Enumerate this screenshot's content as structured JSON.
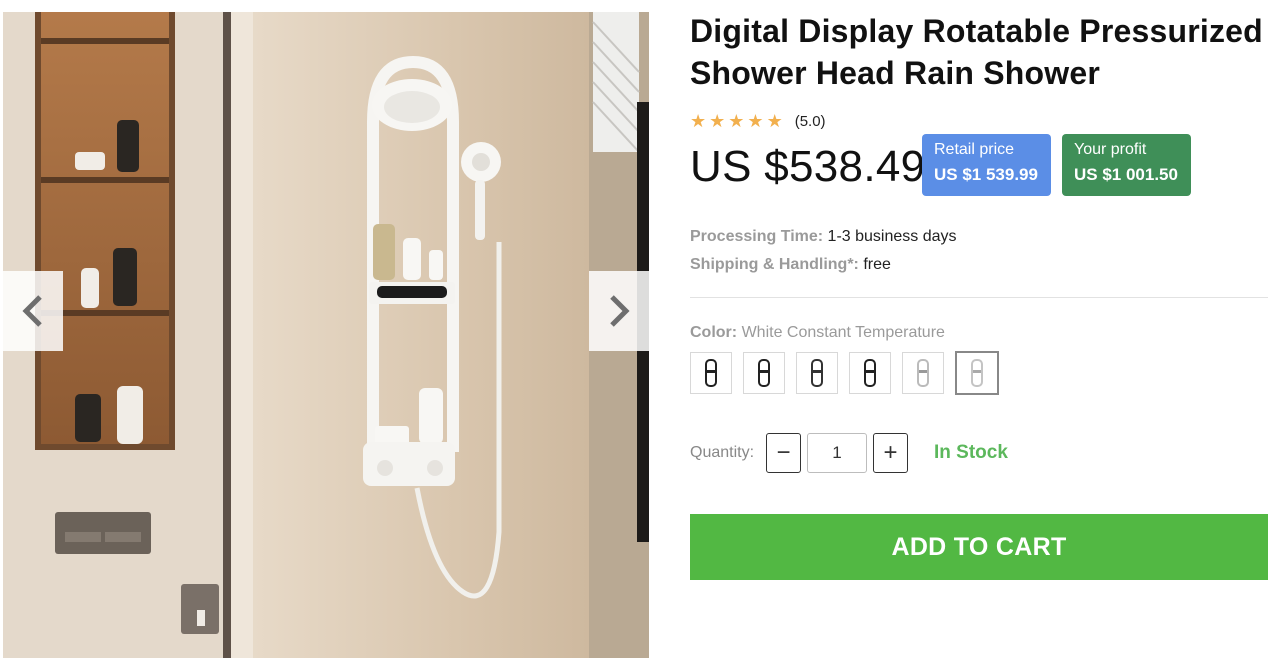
{
  "gallery": {
    "prev_icon": "chevron-left-icon",
    "next_icon": "chevron-right-icon"
  },
  "product": {
    "title": "Digital Display Rotatable Pressurized Shower Head Rain Shower",
    "rating": {
      "stars": 5,
      "text": "(5.0)",
      "star_color": "#f2b04e"
    },
    "price": "US $538.49",
    "retail": {
      "label": "Retail price",
      "value": "US $1 539.99",
      "color": "#5b8ee6"
    },
    "profit": {
      "label": "Your profit",
      "value": "US $1 001.50",
      "color": "#3f8f58"
    },
    "processing": {
      "label": "Processing Time:",
      "value": "1-3 business days"
    },
    "shipping": {
      "label": "Shipping & Handling*:",
      "value": "free"
    },
    "color": {
      "label": "Color:",
      "value": "White Constant Temperature",
      "swatch_count": 6,
      "selected_index": 5
    },
    "quantity": {
      "label": "Quantity:",
      "value": "1",
      "minus": "−",
      "plus": "+"
    },
    "stock": "In Stock",
    "add_to_cart": "ADD TO CART",
    "cart_color": "#52b843"
  }
}
